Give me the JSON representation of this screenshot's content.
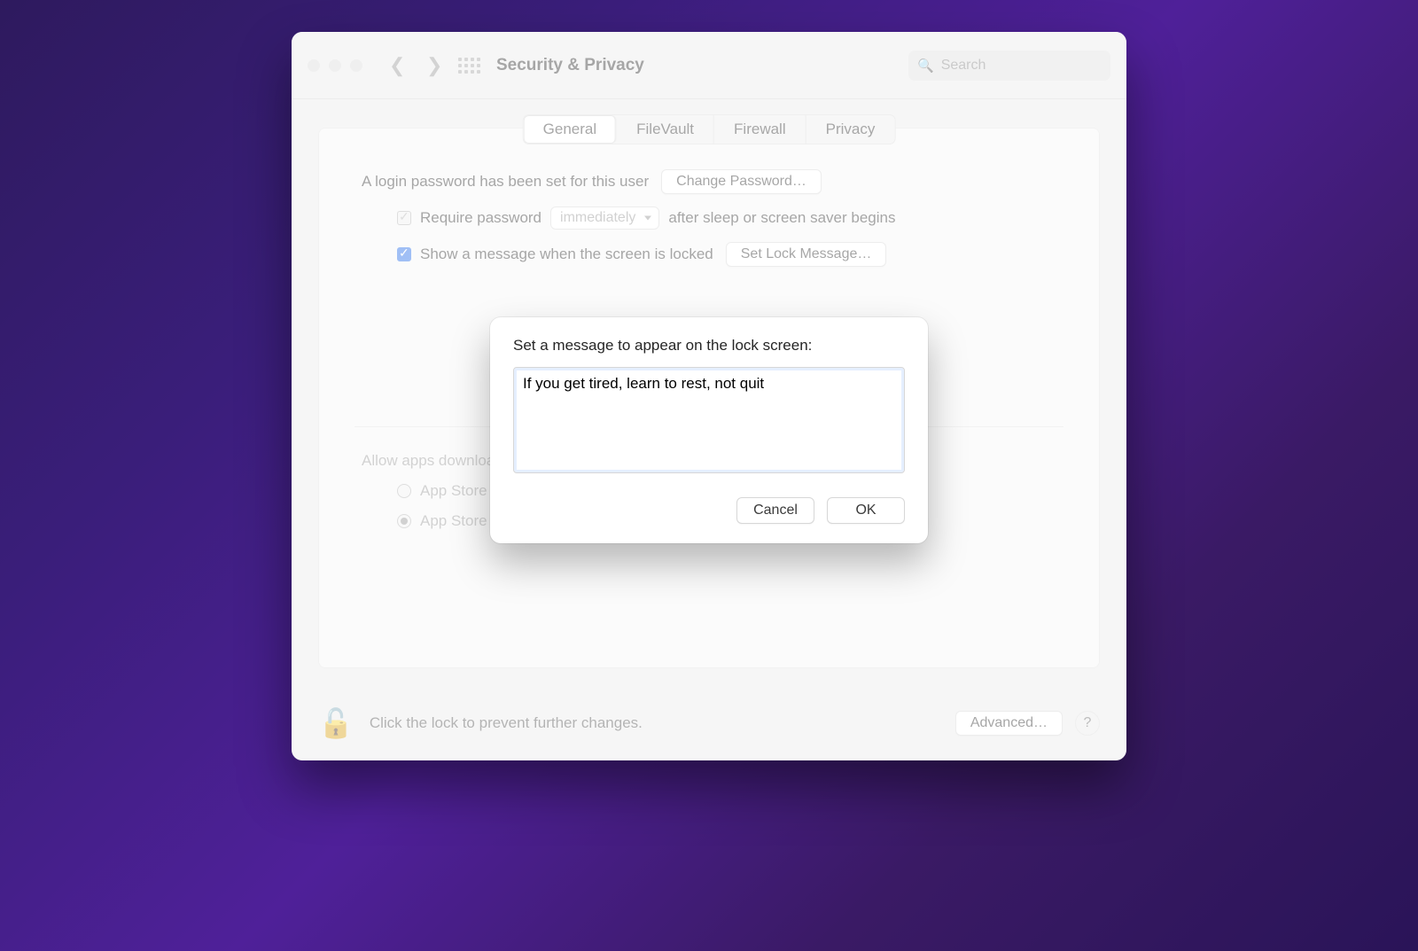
{
  "window": {
    "title": "Security & Privacy"
  },
  "search": {
    "placeholder": "Search"
  },
  "tabs": {
    "general": "General",
    "filevault": "FileVault",
    "firewall": "Firewall",
    "privacy": "Privacy",
    "active": "General"
  },
  "general": {
    "login_password_text": "A login password has been set for this user",
    "change_password_btn": "Change Password…",
    "require_password_label": "Require password",
    "require_password_select": "immediately",
    "require_password_suffix": "after sleep or screen saver begins",
    "show_message_label": "Show a message when the screen is locked",
    "set_lock_message_btn": "Set Lock Message…",
    "allow_apps_heading": "Allow apps downloaded from:",
    "radio_appstore": "App Store",
    "radio_identified": "App Store and identified developers"
  },
  "footer": {
    "lock_text": "Click the lock to prevent further changes.",
    "advanced_btn": "Advanced…"
  },
  "sheet": {
    "prompt": "Set a message to appear on the lock screen:",
    "message_value": "If you get tired, learn to rest, not quit",
    "cancel": "Cancel",
    "ok": "OK"
  }
}
